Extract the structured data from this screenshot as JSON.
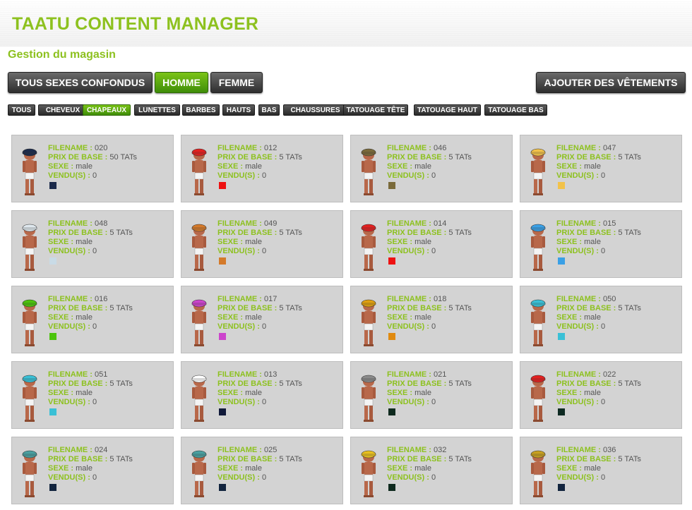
{
  "app": {
    "title": "TAATU CONTENT MANAGER"
  },
  "section": {
    "title": "Gestion du magasin"
  },
  "gender_filter": [
    {
      "label": "TOUS SEXES CONFONDUS",
      "active": false
    },
    {
      "label": "HOMME",
      "active": true
    },
    {
      "label": "FEMME",
      "active": false
    }
  ],
  "add_button": {
    "label": "AJOUTER DES VÊTEMENTS"
  },
  "categories": [
    {
      "label": "TOUS",
      "active": false
    },
    {
      "label": "CHEVEUX",
      "active": false
    },
    {
      "label": "CHAPEAUX",
      "active": true
    },
    {
      "label": "LUNETTES",
      "active": false
    },
    {
      "label": "BARBES",
      "active": false
    },
    {
      "label": "HAUTS",
      "active": false
    },
    {
      "label": "BAS",
      "active": false
    },
    {
      "label": "CHAUSSURES",
      "active": false
    },
    {
      "label": "TATOUAGE TÊTE",
      "active": false
    },
    {
      "label": "TATOUAGE HAUT",
      "active": false
    },
    {
      "label": "TATOUAGE BAS",
      "active": false
    }
  ],
  "labels": {
    "filename": "FILENAME :",
    "price": "PRIX DE BASE :",
    "sex": "SEXE :",
    "sold": "VENDU(S) :"
  },
  "items": [
    {
      "filename": "020",
      "price": "50 TATs",
      "sex": "male",
      "sold": "0",
      "color": "#1b2a4a",
      "hat": "#1b2a4a"
    },
    {
      "filename": "012",
      "price": "5 TATs",
      "sex": "male",
      "sold": "0",
      "color": "#ee1111",
      "hat": "#e32020"
    },
    {
      "filename": "046",
      "price": "5 TATs",
      "sex": "male",
      "sold": "0",
      "color": "#7a6a3a",
      "hat": "#7a6a3a"
    },
    {
      "filename": "047",
      "price": "5 TATs",
      "sex": "male",
      "sold": "0",
      "color": "#f2c24a",
      "hat": "#f2c24a"
    },
    {
      "filename": "048",
      "price": "5 TATs",
      "sex": "male",
      "sold": "0",
      "color": "#c9dbe6",
      "hat": "#dfe8ee"
    },
    {
      "filename": "049",
      "price": "5 TATs",
      "sex": "male",
      "sold": "0",
      "color": "#d47a2a",
      "hat": "#d47a2a"
    },
    {
      "filename": "014",
      "price": "5 TATs",
      "sex": "male",
      "sold": "0",
      "color": "#ee1111",
      "hat": "#e32020"
    },
    {
      "filename": "015",
      "price": "5 TATs",
      "sex": "male",
      "sold": "0",
      "color": "#3aa0e6",
      "hat": "#3aa0e6"
    },
    {
      "filename": "016",
      "price": "5 TATs",
      "sex": "male",
      "sold": "0",
      "color": "#4cc40c",
      "hat": "#4cc40c"
    },
    {
      "filename": "017",
      "price": "5 TATs",
      "sex": "male",
      "sold": "0",
      "color": "#cc44cc",
      "hat": "#cc44cc"
    },
    {
      "filename": "018",
      "price": "5 TATs",
      "sex": "male",
      "sold": "0",
      "color": "#e08a10",
      "hat": "#e0a010"
    },
    {
      "filename": "050",
      "price": "5 TATs",
      "sex": "male",
      "sold": "0",
      "color": "#3ac0d6",
      "hat": "#3ac0d6"
    },
    {
      "filename": "051",
      "price": "5 TATs",
      "sex": "male",
      "sold": "0",
      "color": "#3ac0d6",
      "hat": "#3ac0d6"
    },
    {
      "filename": "013",
      "price": "5 TATs",
      "sex": "male",
      "sold": "0",
      "color": "#111a3a",
      "hat": "#ffffff"
    },
    {
      "filename": "021",
      "price": "5 TATs",
      "sex": "male",
      "sold": "0",
      "color": "#0e2a1e",
      "hat": "#8a8a8a"
    },
    {
      "filename": "022",
      "price": "5 TATs",
      "sex": "male",
      "sold": "0",
      "color": "#0e2a22",
      "hat": "#e32020"
    },
    {
      "filename": "024",
      "price": "5 TATs",
      "sex": "male",
      "sold": "0",
      "color": "#12243e",
      "hat": "#4aa0a0"
    },
    {
      "filename": "025",
      "price": "5 TATs",
      "sex": "male",
      "sold": "0",
      "color": "#12243e",
      "hat": "#4aa0a0"
    },
    {
      "filename": "032",
      "price": "5 TATs",
      "sex": "male",
      "sold": "0",
      "color": "#0e2a1e",
      "hat": "#e8c020"
    },
    {
      "filename": "036",
      "price": "5 TATs",
      "sex": "male",
      "sold": "0",
      "color": "#12243e",
      "hat": "#c8a020"
    }
  ]
}
